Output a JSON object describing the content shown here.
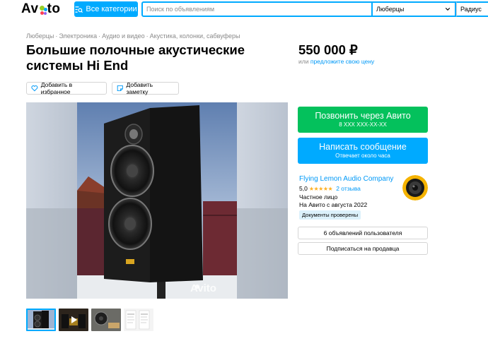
{
  "header": {
    "logo_text_left": "Av",
    "logo_text_right": "to",
    "categories_label": "Все категории",
    "search_placeholder": "Поиск по объявлениям",
    "city": "Люберцы",
    "radius_label": "Радиус"
  },
  "breadcrumb": [
    "Люберцы",
    "Электроника",
    "Аудио и видео",
    "Акустика, колонки, сабвуферы"
  ],
  "listing": {
    "title": "Большие полочные акустические системы Hi End",
    "price": "550 000 ₽",
    "price_or": "или",
    "price_offer_link": "предложите свою цену",
    "favorite_label": "Добавить в избранное",
    "note_label": "Добавить заметку",
    "watermark": "Avito"
  },
  "contact": {
    "call_label": "Позвонить через Авито",
    "call_phone": "8 XXX XXX-XX-XX",
    "message_label": "Написать сообщение",
    "message_sub": "Отвечает около часа"
  },
  "seller": {
    "name": "Flying Lemon Audio Company",
    "rating": "5,0",
    "stars": "★★★★★",
    "reviews": "2 отзыва",
    "type": "Частное лицо",
    "since": "На Авито с августа 2022",
    "verified": "Документы проверены",
    "ads_button": "6 объявлений пользователя",
    "subscribe_button": "Подписаться на продавца"
  },
  "thumbnails": [
    "photo-1",
    "video-2",
    "photo-3",
    "photo-4"
  ],
  "colors": {
    "accent_blue": "#00aaff",
    "call_green": "#04c15c",
    "link_blue": "#0099f7",
    "star": "#ffb021"
  }
}
